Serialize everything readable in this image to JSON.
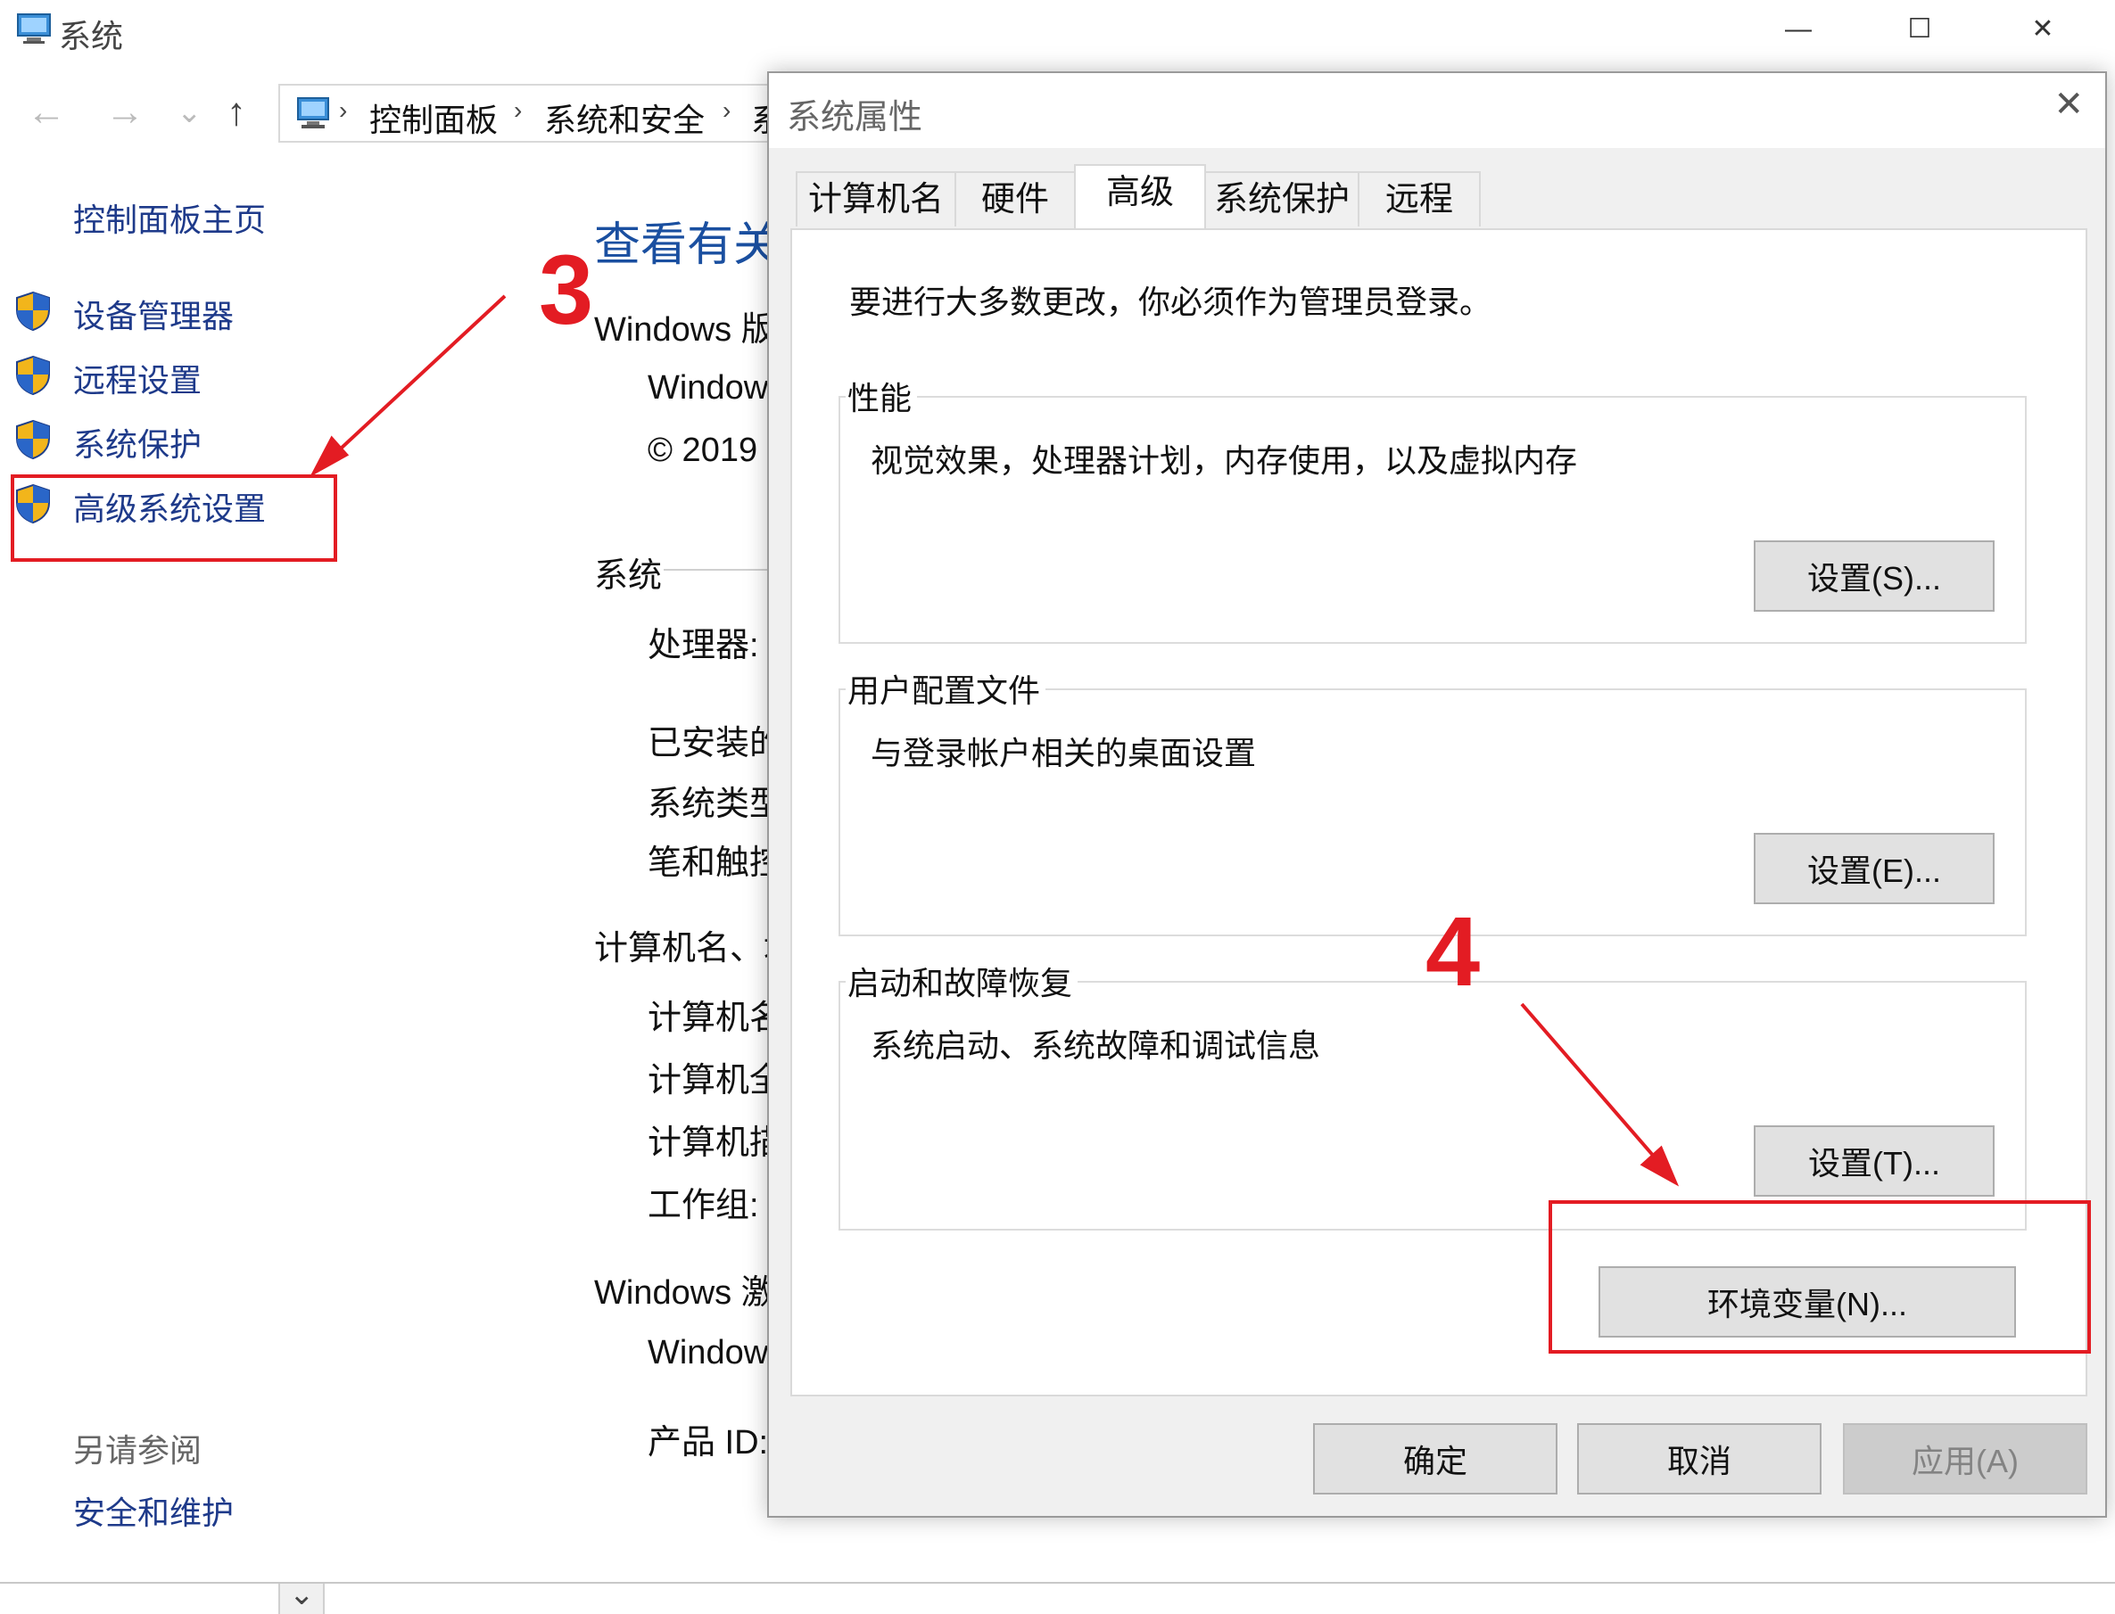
{
  "window": {
    "title": "系统",
    "controls": {
      "minimize": "—",
      "maximize": "☐",
      "close": "✕"
    }
  },
  "address_bar": {
    "back": "←",
    "forward": "→",
    "recent": "⌄",
    "up": "↑",
    "crumbs": [
      "控制面板",
      "系统和安全",
      "系"
    ],
    "separator": "›"
  },
  "sidebar": {
    "home": "控制面板主页",
    "items": [
      {
        "label": "设备管理器",
        "icon": "uac-shield-icon"
      },
      {
        "label": "远程设置",
        "icon": "uac-shield-icon"
      },
      {
        "label": "系统保护",
        "icon": "uac-shield-icon"
      },
      {
        "label": "高级系统设置",
        "icon": "uac-shield-icon"
      }
    ],
    "see_also_title": "另请参阅",
    "see_also_items": [
      "安全和维护"
    ]
  },
  "main": {
    "heading": "查看有关",
    "edition_label": "Windows 版",
    "edition_value": "Window",
    "copyright": "© 2019",
    "system_section": "系统",
    "processor": "处理器:",
    "installed_ram": "已安装的",
    "system_type": "系统类型",
    "pen_touch": "笔和触控",
    "computer_section": "计算机名、域",
    "computer_name": "计算机名",
    "full_computer_name": "计算机全",
    "computer_desc": "计算机描",
    "workgroup": "工作组:",
    "activation_section": "Windows 激",
    "activation_value": "Window",
    "product_id": "产品 ID:"
  },
  "dialog": {
    "title": "系统属性",
    "close": "✕",
    "tabs": [
      "计算机名",
      "硬件",
      "高级",
      "系统保护",
      "远程"
    ],
    "active_tab": "高级",
    "note": "要进行大多数更改，你必须作为管理员登录。",
    "groups": [
      {
        "label": "性能",
        "desc": "视觉效果，处理器计划，内存使用，以及虚拟内存",
        "button": "设置(S)..."
      },
      {
        "label": "用户配置文件",
        "desc": "与登录帐户相关的桌面设置",
        "button": "设置(E)..."
      },
      {
        "label": "启动和故障恢复",
        "desc": "系统启动、系统故障和调试信息",
        "button": "设置(T)..."
      }
    ],
    "env_button": "环境变量(N)...",
    "ok": "确定",
    "cancel": "取消",
    "apply": "应用(A)"
  },
  "annotations": {
    "step3": "3",
    "step4": "4",
    "color": "#e31c23"
  },
  "scroll_down": "⌄"
}
